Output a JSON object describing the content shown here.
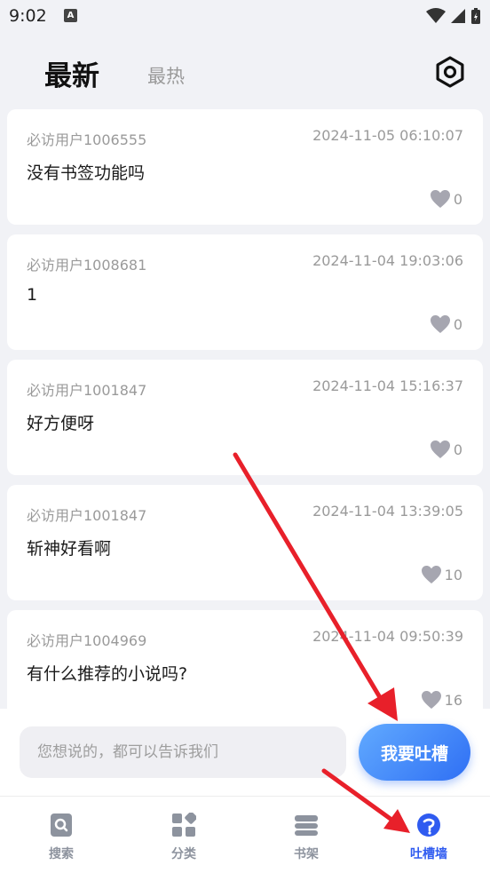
{
  "status_bar": {
    "time": "9:02",
    "notif_letter": "A"
  },
  "header": {
    "tab_latest": "最新",
    "tab_hot": "最热"
  },
  "posts": [
    {
      "user": "必访用户1006555",
      "time": "2024-11-05 06:10:07",
      "text": "没有书签功能吗",
      "likes": "0"
    },
    {
      "user": "必访用户1008681",
      "time": "2024-11-04 19:03:06",
      "text": "1",
      "likes": "0"
    },
    {
      "user": "必访用户1001847",
      "time": "2024-11-04 15:16:37",
      "text": "好方便呀",
      "likes": "0"
    },
    {
      "user": "必访用户1001847",
      "time": "2024-11-04 13:39:05",
      "text": "斩神好看啊",
      "likes": "10"
    },
    {
      "user": "必访用户1004969",
      "time": "2024-11-04 09:50:39",
      "text": "有什么推荐的小说吗?",
      "likes": "16"
    }
  ],
  "composer": {
    "placeholder": "您想说的，都可以告诉我们",
    "submit_label": "我要吐槽"
  },
  "nav": {
    "search": "搜索",
    "category": "分类",
    "shelf": "书架",
    "wall": "吐槽墙"
  },
  "colors": {
    "accent": "#2f5bf0",
    "arrow": "#e8202a"
  }
}
